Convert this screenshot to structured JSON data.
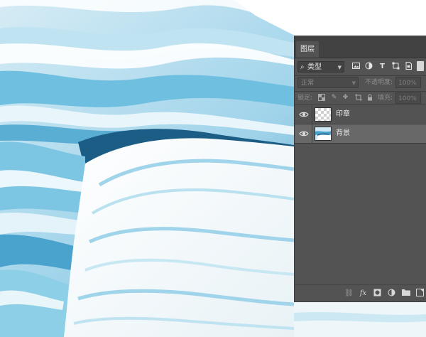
{
  "panel": {
    "tab_label": "图层",
    "filter": {
      "label": "类型"
    },
    "filter_icons": [
      "image-filter-icon",
      "adjustment-filter-icon",
      "type-filter-icon",
      "shape-filter-icon",
      "smart-object-filter-icon"
    ],
    "blend_mode": "正常",
    "opacity_label": "不透明度:",
    "opacity_value": "100%",
    "lock_label": "锁定:",
    "fill_label": "填充:",
    "fill_value": "100%",
    "layers": [
      {
        "name": "印章",
        "visible": true,
        "selected": false
      },
      {
        "name": "背景",
        "visible": true,
        "selected": true
      }
    ]
  },
  "colors": {
    "panel_bg": "#535353",
    "tab_bar": "#424242",
    "selected_layer": "#686868",
    "ice_light": "#f4f9fb",
    "ice_mid": "#7cc6e3",
    "ice_dark": "#1b5d85"
  }
}
